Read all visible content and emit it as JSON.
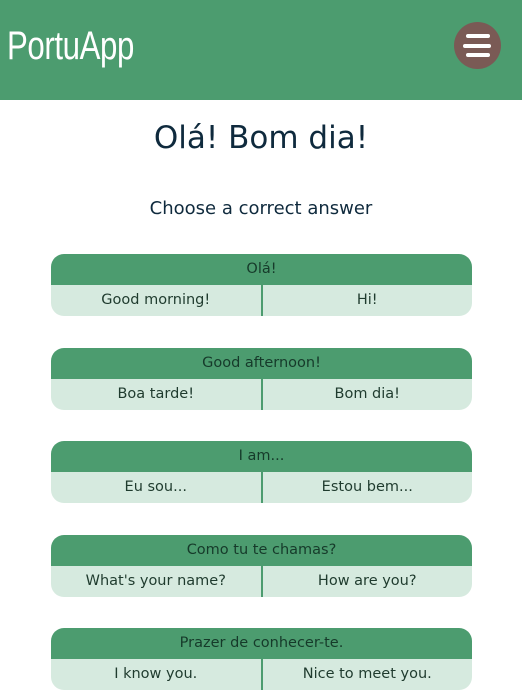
{
  "app": {
    "name": "PortuApp"
  },
  "main": {
    "title": "Olá! Bom dia!",
    "instruction": "Choose a correct answer"
  },
  "questions": [
    {
      "prompt": "Olá!",
      "options": [
        "Good morning!",
        "Hi!"
      ]
    },
    {
      "prompt": "Good afternoon!",
      "options": [
        "Boa tarde!",
        "Bom dia!"
      ]
    },
    {
      "prompt": "I am...",
      "options": [
        "Eu sou...",
        "Estou bem..."
      ]
    },
    {
      "prompt": "Como tu te chamas?",
      "options": [
        "What's your name?",
        "How are you?"
      ]
    },
    {
      "prompt": "Prazer de conhecer-te.",
      "options": [
        "I know you.",
        "Nice to meet you."
      ]
    }
  ],
  "colors": {
    "header": "#4c9c6f",
    "menu_button": "#7a5a55",
    "answer_bg": "#d6eadf",
    "text": "#0f2a3d"
  }
}
